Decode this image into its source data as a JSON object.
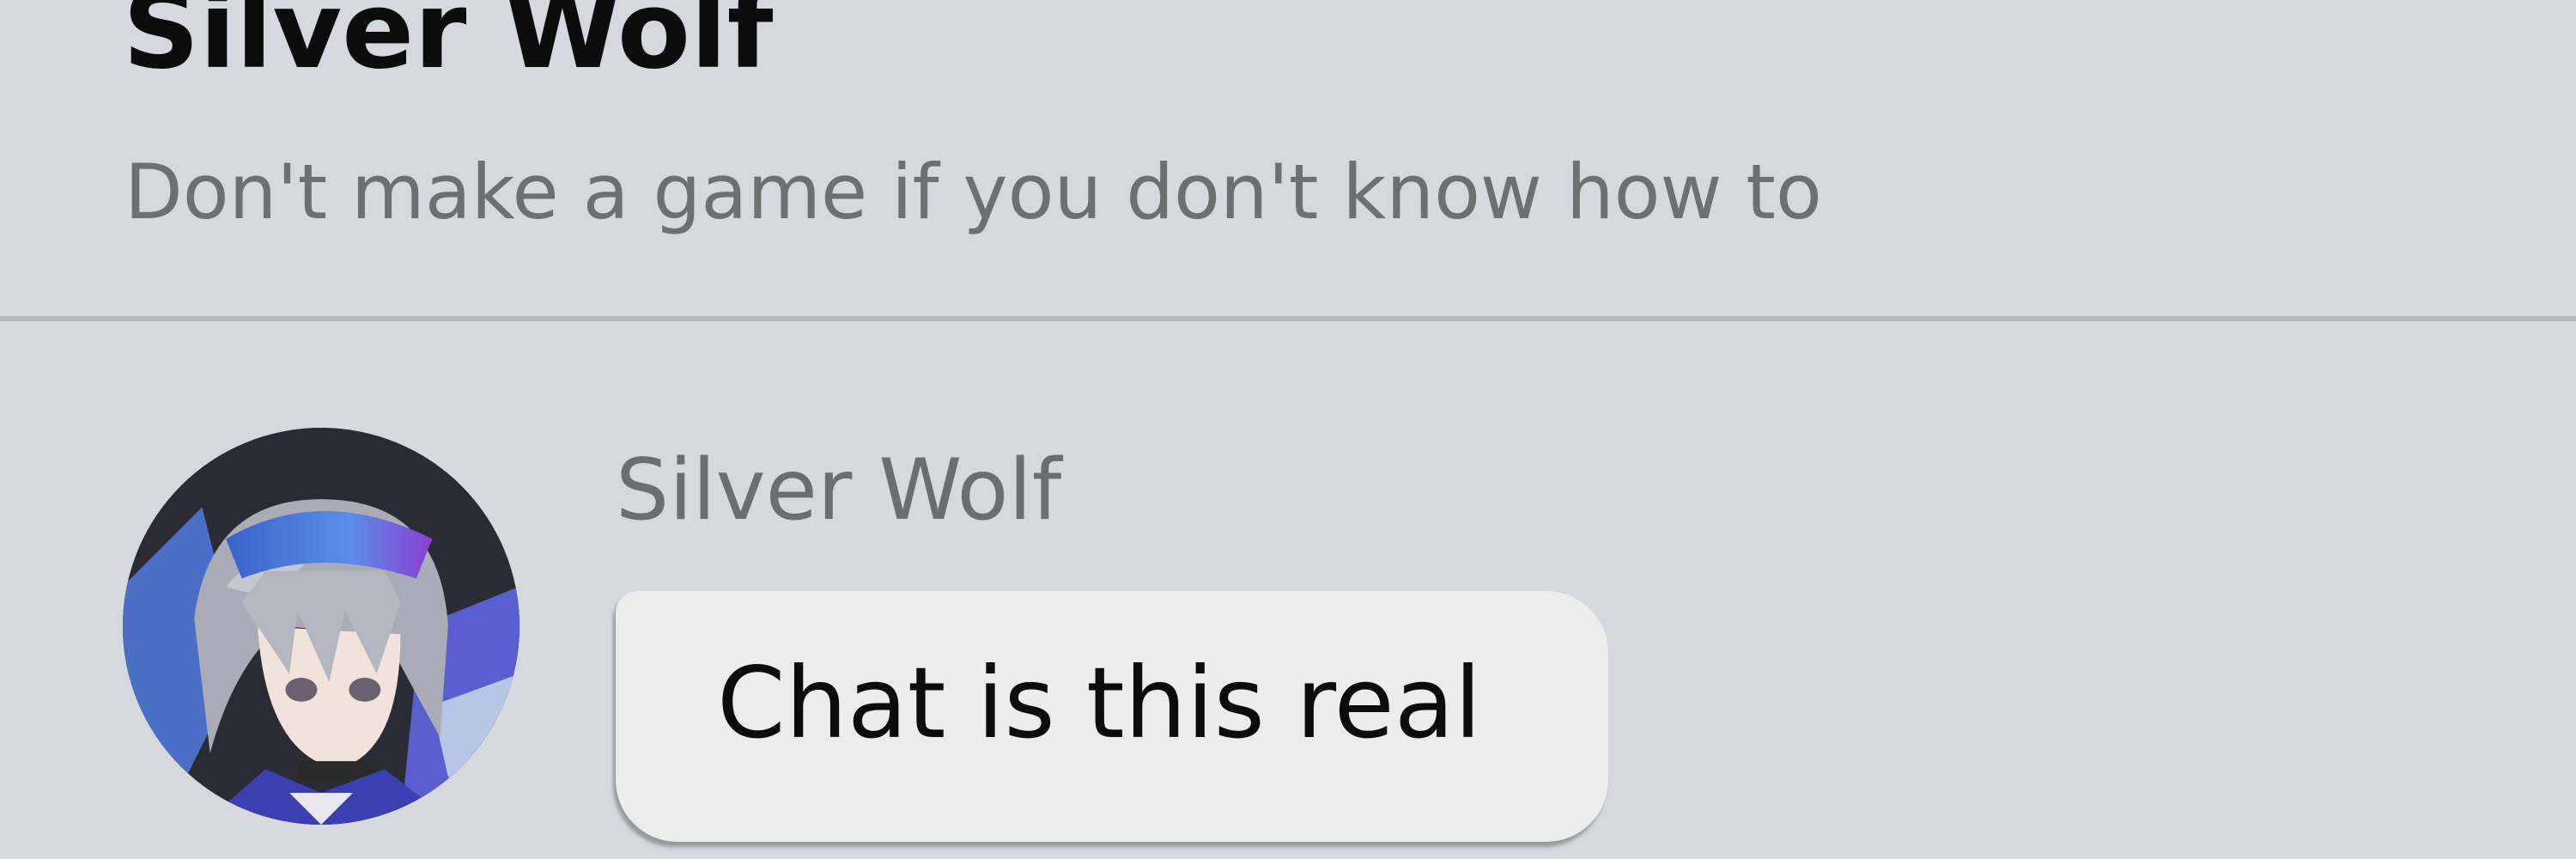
{
  "chat": {
    "title": "Silver Wolf",
    "subtitle": "Don't make a game if you don't know how to"
  },
  "message": {
    "sender": "Silver Wolf",
    "text": "Chat is this real",
    "avatar_icon": "silver-wolf-avatar"
  },
  "colors": {
    "background": "#d5d9dd",
    "divider": "#b3b8bd",
    "bubble": "#ececec",
    "title_text": "#0c0c0c",
    "muted_text": "#6d6f71"
  }
}
